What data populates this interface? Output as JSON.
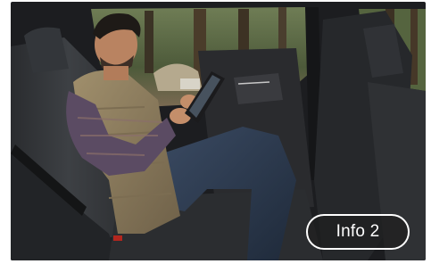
{
  "info_button": {
    "label": "Info 2"
  },
  "photo": {
    "subject": "man-with-tablet-in-rear-seat",
    "colors": {
      "forest": "#5a6b45",
      "seat": "#3b3d40",
      "vest": "#8a7a5c",
      "shirt": "#5b4b63",
      "jeans": "#2c3a4f",
      "door_panel": "#2a2b2e"
    }
  }
}
